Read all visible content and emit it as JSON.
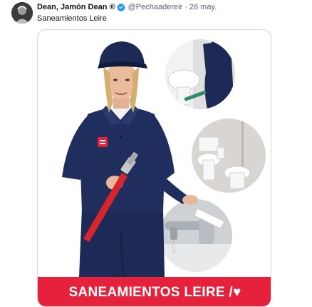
{
  "tweet": {
    "author": {
      "display_name": "Dean, Jamón Dean ®",
      "handle": "@Pechaadereir",
      "verified": true
    },
    "separator": "·",
    "date": "26 may.",
    "text": "Saneamientos Leire",
    "media": {
      "banner_text": "SANEAMIENTOS LEIRE /♥",
      "banner_color": "#e5213b",
      "images": [
        "plumber-figure",
        "toilet-repair-photo",
        "toilet-bidet-photo",
        "faucet-leak-photo"
      ]
    }
  },
  "colors": {
    "verified_badge": "#1d9bf0",
    "secondary_text": "#536471",
    "uniform_navy": "#1c2a55",
    "wrench_red": "#d9232e"
  }
}
